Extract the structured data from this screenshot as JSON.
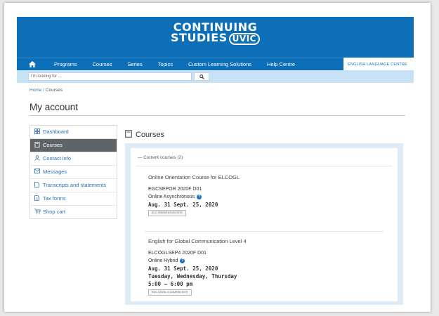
{
  "header": {
    "logo_line1": "CONTINUING",
    "logo_line2": "STUDIES",
    "logo_badge": "UVIC"
  },
  "nav": {
    "items": [
      "Programs",
      "Courses",
      "Series",
      "Topics",
      "Custom Learning Solutions",
      "Help Centre"
    ],
    "elc_label": "ENGLISH LANGUAGE CENTRE"
  },
  "search": {
    "placeholder": "I'm looking for ..."
  },
  "breadcrumb": {
    "home": "Home",
    "separator": "/",
    "current": "Courses"
  },
  "page_title": "My account",
  "sidebar": {
    "items": [
      {
        "label": "Dashboard",
        "icon": "dashboard-icon"
      },
      {
        "label": "Courses",
        "icon": "book-icon"
      },
      {
        "label": "Contact info",
        "icon": "person-icon"
      },
      {
        "label": "Messages",
        "icon": "envelope-icon"
      },
      {
        "label": "Transcripts and statements",
        "icon": "document-icon"
      },
      {
        "label": "Tax forms",
        "icon": "document-icon"
      },
      {
        "label": "Shop cart",
        "icon": "cart-icon"
      }
    ]
  },
  "courses": {
    "heading": "Courses",
    "current_label": "— Current courses (2)",
    "list": [
      {
        "name": "Online Orientation Course for ELCOGL",
        "code": "EGCSEPOR 2020F D01",
        "format": "Online Asynchronous",
        "dates": "Aug. 31   Sept. 25, 2020",
        "site_button": "ELC ORIENTATION SITE"
      },
      {
        "name": "English for Global Communication Level 4",
        "code": "ELCOGLSEP4 2020F D01",
        "format": "Online Hybrid",
        "dates": "Aug. 31   Sept. 25, 2020",
        "days": "Tuesday, Wednesday, Thursday",
        "time": "5:00 – 6:00 pm",
        "site_button": "EGC LEVEL 4 COURSE SITE"
      }
    ]
  },
  "colors": {
    "brand_blue": "#0d6fb8",
    "search_bar": "#c7e2f4",
    "active_sidebar": "#5f6468",
    "panel_bg": "#dcebf6"
  }
}
